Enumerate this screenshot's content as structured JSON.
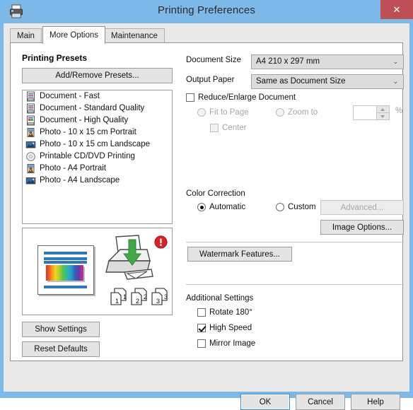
{
  "window": {
    "title": "Printing Preferences",
    "printer_icon": "printer-icon",
    "close_label": "✕",
    "titlebar_color": "#7db9e8",
    "close_button_color": "#bf4f56"
  },
  "tabs": [
    {
      "label": "Main",
      "active": false
    },
    {
      "label": "More Options",
      "active": true
    },
    {
      "label": "Maintenance",
      "active": false
    }
  ],
  "presets": {
    "heading": "Printing Presets",
    "add_remove_label": "Add/Remove Presets...",
    "items": [
      {
        "label": "Document - Fast",
        "icon": "document-icon"
      },
      {
        "label": "Document - Standard Quality",
        "icon": "document-icon"
      },
      {
        "label": "Document - High Quality",
        "icon": "document-color-icon"
      },
      {
        "label": "Photo - 10 x 15 cm Portrait",
        "icon": "photo-portrait-icon"
      },
      {
        "label": "Photo - 10 x 15 cm Landscape",
        "icon": "photo-landscape-icon"
      },
      {
        "label": "Printable CD/DVD Printing",
        "icon": "cd-disc-icon"
      },
      {
        "label": "Photo - A4 Portrait",
        "icon": "photo-portrait-icon"
      },
      {
        "label": "Photo - A4 Landscape",
        "icon": "photo-landscape-icon"
      }
    ]
  },
  "preview": {
    "document_icon": "document-preview-icon",
    "printer_icon": "printer-feed-icon",
    "warning_icon": "warning-badge-icon",
    "page_numbers": [
      "1",
      "2",
      "3"
    ],
    "accent_green": "#3faa46",
    "accent_red": "#d6222a",
    "doc_line_color": "#2e77bd"
  },
  "left_buttons": {
    "show_settings": "Show Settings",
    "reset_defaults": "Reset Defaults"
  },
  "paper": {
    "document_size_label": "Document Size",
    "document_size_value": "A4 210 x 297 mm",
    "output_paper_label": "Output Paper",
    "output_paper_value": "Same as Document Size",
    "dropdown_arrow": "⌄"
  },
  "reduce_enlarge": {
    "label": "Reduce/Enlarge Document",
    "checked": false,
    "fit_to_page_label": "Fit to Page",
    "zoom_to_label": "Zoom to",
    "center_label": "Center",
    "zoom_value": "",
    "percent_sign": "%"
  },
  "color_correction": {
    "label": "Color Correction",
    "automatic_label": "Automatic",
    "custom_label": "Custom",
    "selected": "Automatic",
    "advanced_label": "Advanced...",
    "advanced_enabled": false,
    "image_options_label": "Image Options..."
  },
  "watermark": {
    "label": "Watermark Features..."
  },
  "additional_settings": {
    "label": "Additional Settings",
    "options": [
      {
        "label": "Rotate 180°",
        "checked": false
      },
      {
        "label": "High Speed",
        "checked": true
      },
      {
        "label": "Mirror Image",
        "checked": false
      }
    ]
  },
  "footer": {
    "ok": "OK",
    "cancel": "Cancel",
    "help": "Help"
  }
}
